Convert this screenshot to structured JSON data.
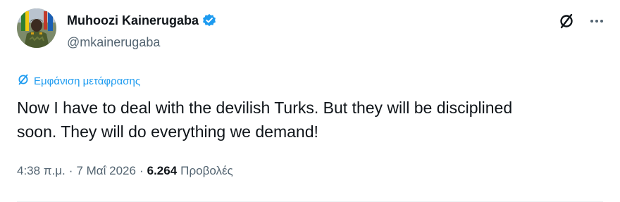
{
  "author": {
    "display_name": "Muhoozi Kainerugaba",
    "handle": "@mkainerugaba",
    "verified": true,
    "verified_color": "#1d9bf0"
  },
  "actions": {
    "grok_icon": "grok-slash-circle-icon",
    "more_icon": "more-dots-icon"
  },
  "translate": {
    "label": "Εμφάνιση μετάφρασης",
    "icon": "translate-slash-circle-icon",
    "color": "#1d9bf0"
  },
  "tweet": {
    "text": "Now I have to deal with the devilish Turks. But they will be disciplined\nsoon. They will do everything we demand!"
  },
  "meta": {
    "time": "4:38 π.μ.",
    "separator_1": "·",
    "date": "7 Μαΐ 2026",
    "separator_2": "·",
    "views_count": "6.264",
    "views_label": "Προβολές"
  }
}
